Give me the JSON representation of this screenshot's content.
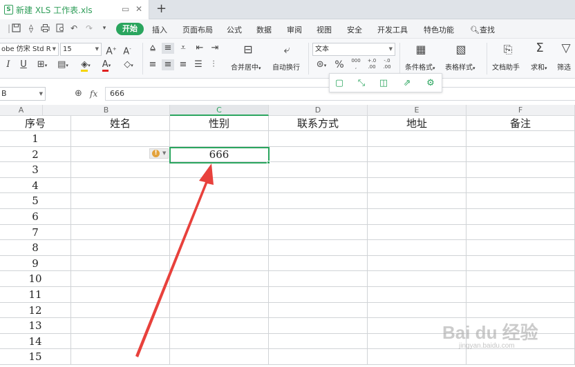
{
  "tab": {
    "icon_letter": "S",
    "title": "新建 XLS 工作表.xls",
    "new_tab": "+",
    "tab_controls": [
      "▭",
      "✕"
    ]
  },
  "menu": {
    "start": "开始",
    "items": [
      "插入",
      "页面布局",
      "公式",
      "数据",
      "审阅",
      "视图",
      "安全",
      "开发工具",
      "特色功能"
    ],
    "search": "查找"
  },
  "ribbon": {
    "font_name": "obe 仿宋 Std R",
    "font_size": "15",
    "merge_label": "合并居中",
    "wrap_label": "自动换行",
    "number_format": "文本",
    "percent": "%",
    "thousands": "000",
    "dec_inc": "+.0\n.00",
    "dec_dec": "-.0\n.00",
    "cond_format": "条件格式",
    "table_style": "表格样式",
    "doc_helper": "文档助手",
    "sum": "求和",
    "filter": "筛选"
  },
  "formula_bar": {
    "name_box": "B",
    "fx": "fx",
    "value": "666"
  },
  "columns": [
    "A",
    "B",
    "C",
    "D",
    "E",
    "F"
  ],
  "header_row": [
    "序号",
    "姓名",
    "性别",
    "联系方式",
    "地址",
    "备注"
  ],
  "rows": [
    {
      "num": "1",
      "cells": [
        "",
        "",
        "",
        "",
        ""
      ]
    },
    {
      "num": "2",
      "cells": [
        "",
        "666",
        "",
        "",
        ""
      ]
    },
    {
      "num": "3",
      "cells": [
        "",
        "",
        "",
        "",
        ""
      ]
    },
    {
      "num": "4",
      "cells": [
        "",
        "",
        "",
        "",
        ""
      ]
    },
    {
      "num": "5",
      "cells": [
        "",
        "",
        "",
        "",
        ""
      ]
    },
    {
      "num": "6",
      "cells": [
        "",
        "",
        "",
        "",
        ""
      ]
    },
    {
      "num": "7",
      "cells": [
        "",
        "",
        "",
        "",
        ""
      ]
    },
    {
      "num": "8",
      "cells": [
        "",
        "",
        "",
        "",
        ""
      ]
    },
    {
      "num": "9",
      "cells": [
        "",
        "",
        "",
        "",
        ""
      ]
    },
    {
      "num": "10",
      "cells": [
        "",
        "",
        "",
        "",
        ""
      ]
    },
    {
      "num": "11",
      "cells": [
        "",
        "",
        "",
        "",
        ""
      ]
    },
    {
      "num": "12",
      "cells": [
        "",
        "",
        "",
        "",
        ""
      ]
    },
    {
      "num": "13",
      "cells": [
        "",
        "",
        "",
        "",
        ""
      ]
    },
    {
      "num": "14",
      "cells": [
        "",
        "",
        "",
        "",
        ""
      ]
    },
    {
      "num": "15",
      "cells": [
        "",
        "",
        "",
        "",
        ""
      ]
    }
  ],
  "watermark": {
    "brand": "Bai du 经验",
    "url": "jingyan.baidu.com"
  },
  "colors": {
    "accent": "#2aa55e",
    "annotation_arrow": "#e8413c",
    "warning": "#e3a23b"
  }
}
